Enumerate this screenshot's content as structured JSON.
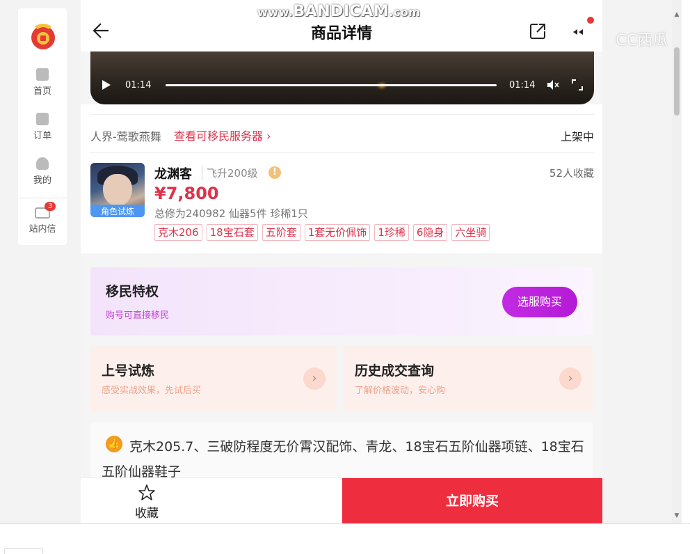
{
  "watermark": {
    "www": "www.",
    "brand": "BANDICAM",
    "com": ".com"
  },
  "cc_mark": "CC西瓜",
  "sidebar": {
    "items": [
      {
        "label": "首页",
        "icon": "home-icon"
      },
      {
        "label": "订单",
        "icon": "order-icon"
      },
      {
        "label": "我的",
        "icon": "person-icon"
      },
      {
        "label": "站内信",
        "icon": "mail-icon",
        "badge": "3"
      }
    ]
  },
  "header": {
    "title": "商品详情"
  },
  "video": {
    "time_current": "01:14",
    "time_total": "01:14"
  },
  "server": {
    "name": "人界-莺歌燕舞",
    "link": "查看可移民服务器",
    "status": "上架中"
  },
  "product": {
    "name": "龙渊客",
    "level": "飞升200级",
    "fav_count": "52人收藏",
    "price": "¥7,800",
    "stats": "总修为240982  仙器5件  珍稀1只",
    "avatar_tag": "角色试炼",
    "tags": [
      "克木206",
      "18宝石套",
      "五阶套",
      "1套无价佩饰",
      "1珍稀",
      "6隐身",
      "六坐骑"
    ]
  },
  "privilege": {
    "title": "移民特权",
    "subtitle": "购号可直接移民",
    "button": "选服购买"
  },
  "cards": [
    {
      "title": "上号试炼",
      "subtitle": "感受实战效果，先试后买"
    },
    {
      "title": "历史成交查询",
      "subtitle": "了解价格波动，安心购"
    }
  ],
  "description": "克木205.7、三破防程度无价霄汉配饰、青龙、18宝石五阶仙器项链、18宝石五阶仙器鞋子",
  "bottom": {
    "fav_label": "收藏",
    "buy_label": "立即购买"
  },
  "colors": {
    "accent": "#e0314a",
    "buy": "#ee2d3e",
    "privilege_button": "#c22be3",
    "avatar_tag": "#4d97f2"
  }
}
